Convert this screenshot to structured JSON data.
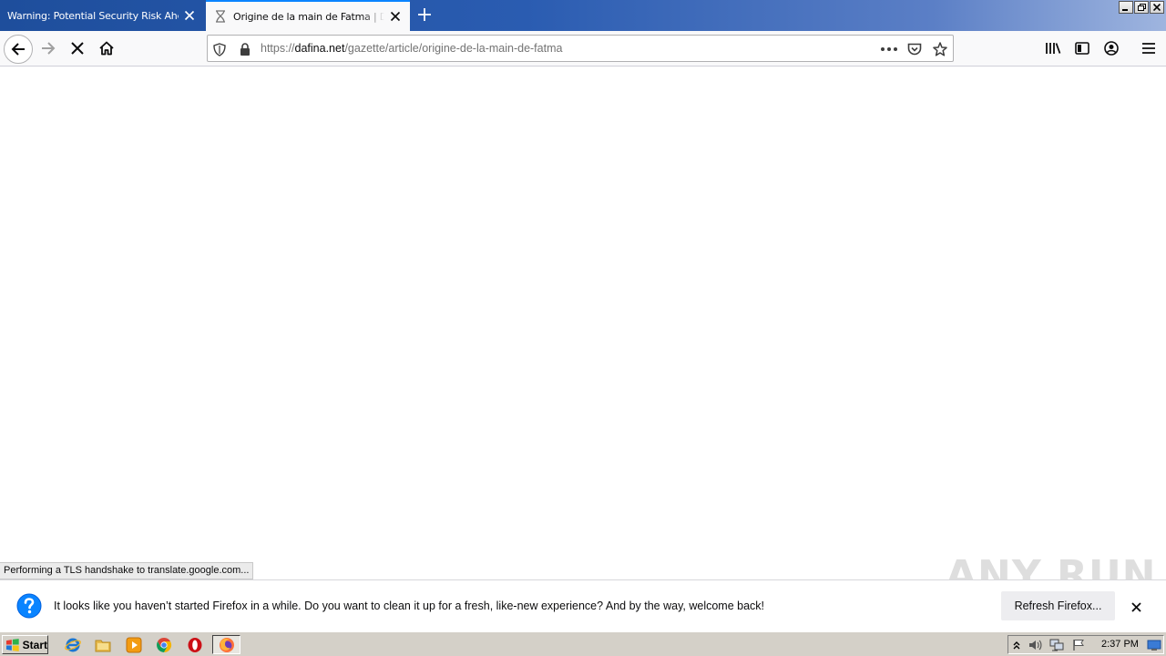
{
  "browser": {
    "tabs": [
      {
        "title": "Warning: Potential Security Risk Ahead",
        "active": false
      },
      {
        "title": "Origine de la main de Fatma | Dafina",
        "active": true
      }
    ],
    "url": {
      "scheme": "https://",
      "host": "dafina.net",
      "path": "/gazette/article/origine-de-la-main-de-fatma"
    },
    "status_text": "Performing a TLS handshake to translate.google.com..."
  },
  "notification": {
    "message": "It looks like you haven’t started Firefox in a while. Do you want to clean it up for a fresh, like-new experience? And by the way, welcome back!",
    "button_label": "Refresh Firefox..."
  },
  "watermark": "ANY RUN",
  "taskbar": {
    "start_label": "Start",
    "clock": "2:37 PM",
    "pinned": [
      "ie-icon",
      "explorer-icon",
      "media-player-icon",
      "chrome-icon",
      "opera-icon",
      "firefox-icon"
    ]
  },
  "colors": {
    "tab_strip": "#2a5cb1",
    "active_tab_accent": "#0a84ff",
    "notification_icon": "#0a84ff"
  }
}
